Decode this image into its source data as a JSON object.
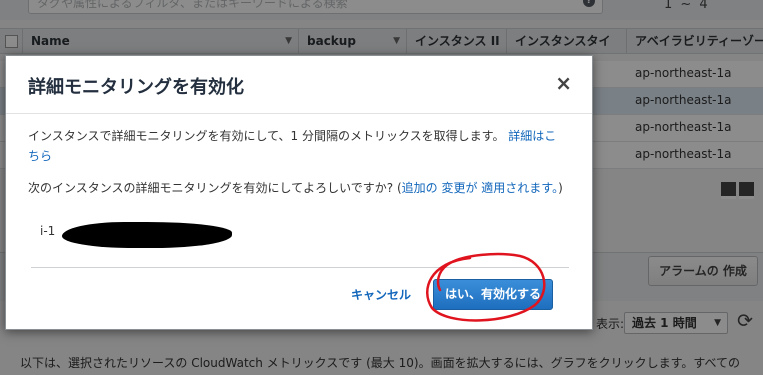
{
  "search": {
    "placeholder": "タグや属性によるフィルタ、またはキーワードによる検索"
  },
  "pagination": {
    "text": "1 ~ 4"
  },
  "table": {
    "columns": [
      "Name",
      "backup",
      "インスタンス II",
      "インスタンスタイ",
      "アベイラビリティーゾーン"
    ],
    "rows": [
      {
        "az": "ap-northeast-1a",
        "selected": false
      },
      {
        "az": "ap-northeast-1a",
        "selected": true
      },
      {
        "az": "ap-northeast-1a",
        "selected": false
      },
      {
        "az": "ap-northeast-1a",
        "selected": false
      }
    ]
  },
  "monitoring": {
    "alarm_button": "アラームの 作成",
    "display_label": "表示:",
    "period_value": "過去 1 時間",
    "cloudwatch_text": "以下は、選択されたリソースの CloudWatch メトリックスです (最大 10)。画面を拡大するには、グラフをクリックします。すべての"
  },
  "modal": {
    "title": "詳細モニタリングを有効化",
    "close_icon": "×",
    "body1_text": "インスタンスで詳細モニタリングを有効にして、1 分間隔のメトリックスを取得します。",
    "body1_link": "詳細はこちら",
    "body2_text": "次のインスタンスの詳細モニタリングを有効にしてよろしいですか? (",
    "body2_link": "追加の 変更が 適用されます。",
    "body2_close": ")",
    "instance_prefix": "i-1",
    "cancel_label": "キャンセル",
    "confirm_label": "はい、有効化する"
  },
  "colors": {
    "link": "#1166bb",
    "primary": "#2a7bcc",
    "annotation": "#e0141e"
  }
}
